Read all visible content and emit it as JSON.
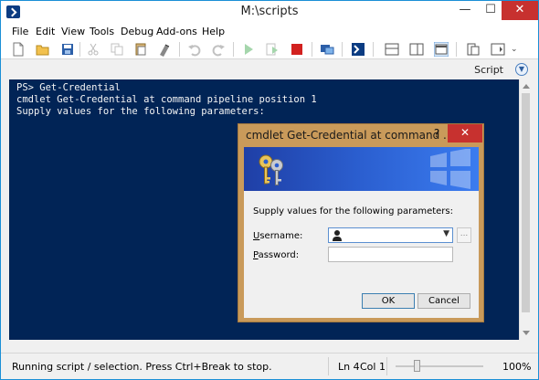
{
  "window": {
    "title": "M:\\scripts"
  },
  "titlebar": {
    "minimize": "—",
    "maximize": "☐",
    "close": "✕"
  },
  "menu": [
    "File",
    "Edit",
    "View",
    "Tools",
    "Debug",
    "Add-ons",
    "Help"
  ],
  "toolbar": {
    "icons": [
      "new-script-icon",
      "open-icon",
      "save-icon",
      "cut-icon",
      "copy-icon",
      "paste-icon",
      "clear-icon",
      "undo-icon",
      "redo-icon",
      "run-icon",
      "run-selection-icon",
      "stop-icon",
      "remote-powershell-icon",
      "powershell-console-icon",
      "show-script-top-icon",
      "show-script-right-icon",
      "show-script-max-icon",
      "show-command-window-icon",
      "show-command-addon-icon"
    ]
  },
  "script_pane": {
    "label": "Script"
  },
  "console": {
    "lines": [
      "PS> Get-Credential",
      "cmdlet Get-Credential at command pipeline position 1",
      "Supply values for the following parameters:"
    ]
  },
  "dialog": {
    "title": "cmdlet Get-Credential at command ...",
    "help": "?",
    "close": "✕",
    "prompt": "Supply values for the following parameters:",
    "username_label_key": "U",
    "username_label_rest": "sername:",
    "password_label_key": "P",
    "password_label_rest": "assword:",
    "username_value": "",
    "password_value": "",
    "browse": "...",
    "ok": "OK",
    "cancel": "Cancel"
  },
  "status": {
    "message": "Running script / selection.  Press Ctrl+Break to stop.",
    "line": "Ln 4",
    "col": "Col 1",
    "zoom": "100%"
  },
  "colors": {
    "console_bg": "#012456",
    "dialog_frame": "#c99a5a",
    "accent": "#1b8fd6",
    "close_red": "#c7312f"
  }
}
